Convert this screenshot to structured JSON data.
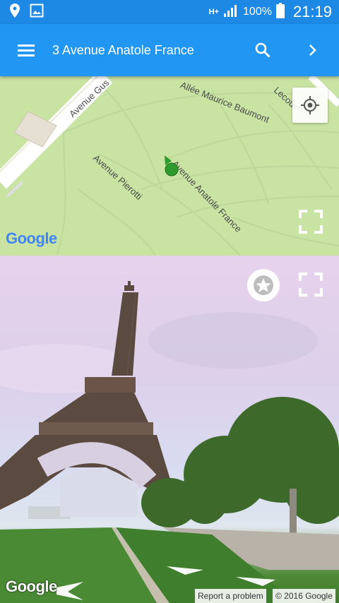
{
  "status_bar": {
    "network": "H+",
    "battery": "100%",
    "time": "21:19",
    "icons": [
      "location-icon",
      "image-icon",
      "signal-icon",
      "battery-icon"
    ]
  },
  "app_bar": {
    "title": "3 Avenue Anatole France",
    "icons": [
      "menu-icon",
      "search-icon",
      "chevron-right-icon"
    ]
  },
  "map": {
    "streets": [
      "Avenue Gus",
      "Allée Maurice Baumont",
      "Lecouv",
      "Avenue Pierotti",
      "Avenue Anatole France"
    ],
    "logo": "Google",
    "colors": {
      "park": "#c9e3a3",
      "road": "#ffffff",
      "marker": "#2e9b2e"
    }
  },
  "street_view": {
    "logo": "Google",
    "report_link": "Report a problem",
    "copyright": "© 2016 Google"
  },
  "theme": {
    "primary": "#2196f3",
    "status": "#1e88e5"
  }
}
